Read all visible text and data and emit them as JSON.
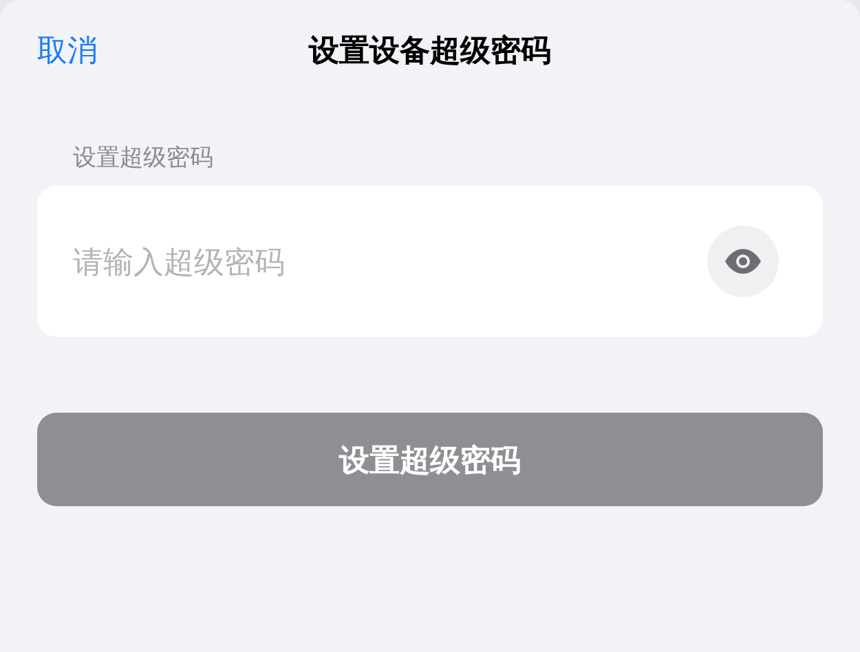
{
  "header": {
    "cancel": "取消",
    "title": "设置设备超级密码"
  },
  "section_label": "设置超级密码",
  "password_field": {
    "placeholder": "请输入超级密码"
  },
  "submit_button": {
    "label": "设置超级密码",
    "disabled": true
  }
}
